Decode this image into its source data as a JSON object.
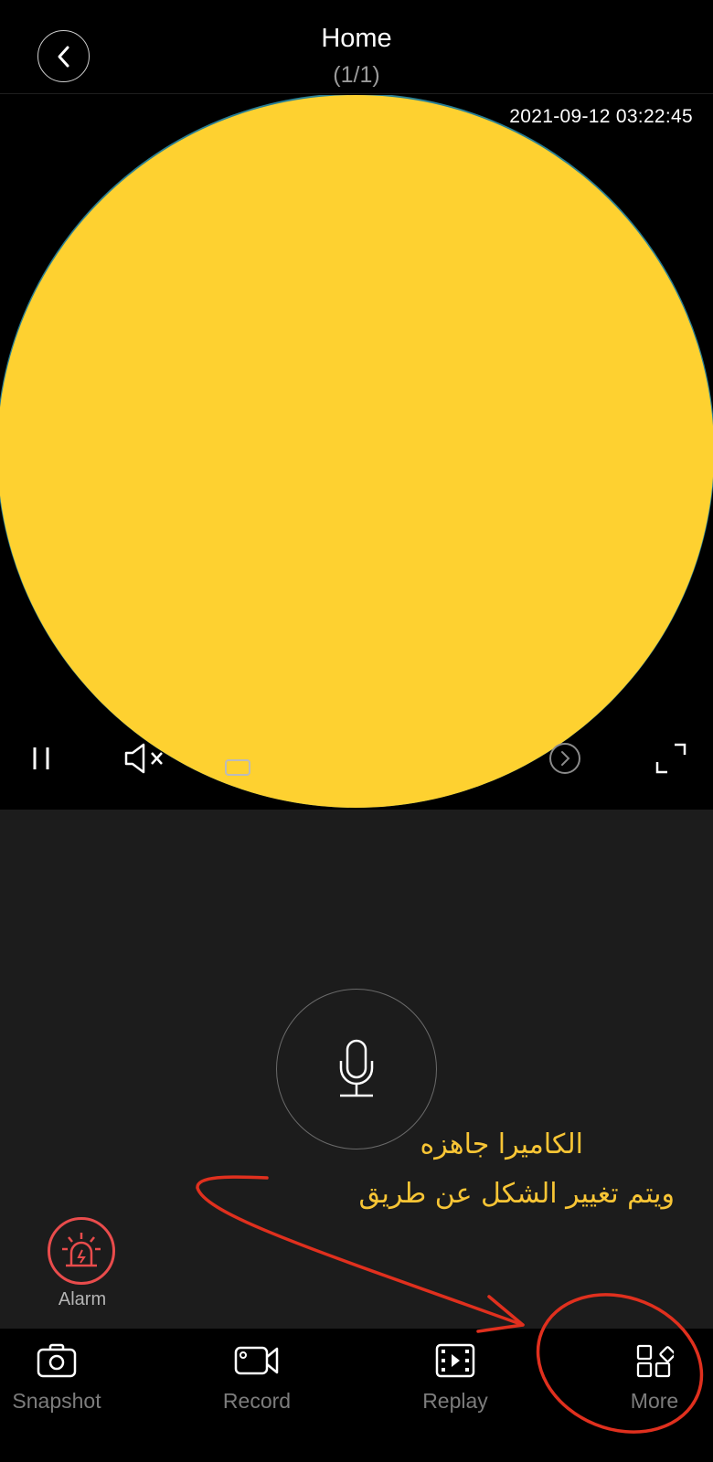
{
  "header": {
    "title": "Home",
    "subtitle": "(1/1)",
    "back_icon": "chevron-left-icon"
  },
  "video": {
    "timestamp": "2021-09-12 03:22:45",
    "feed_color": "#fed130",
    "controls": [
      {
        "id": "pause",
        "icon": "pause-icon"
      },
      {
        "id": "mute",
        "icon": "speaker-muted-icon"
      },
      {
        "id": "quality",
        "icon": "hd-badge-icon"
      },
      {
        "id": "next",
        "icon": "chevron-right-circle-icon"
      },
      {
        "id": "fullscreen",
        "icon": "fullscreen-icon"
      }
    ]
  },
  "panel": {
    "talk_icon": "microphone-icon",
    "annotation_text": {
      "line1": "الكاميرا جاهزه",
      "line2": "ويتم تغيير الشكل عن طريق",
      "color": "#f8c535"
    },
    "alarm": {
      "label": "Alarm",
      "icon": "siren-icon",
      "color": "#e94c4c"
    }
  },
  "tabbar": {
    "items": [
      {
        "label": "Snapshot",
        "icon": "camera-icon"
      },
      {
        "label": "Record",
        "icon": "video-camera-icon"
      },
      {
        "label": "Replay",
        "icon": "film-play-icon"
      },
      {
        "label": "More",
        "icon": "grid-more-icon"
      }
    ]
  },
  "annotation_marks": {
    "color": "#e0301e",
    "arrow_target": "More",
    "circle_target": "More"
  }
}
